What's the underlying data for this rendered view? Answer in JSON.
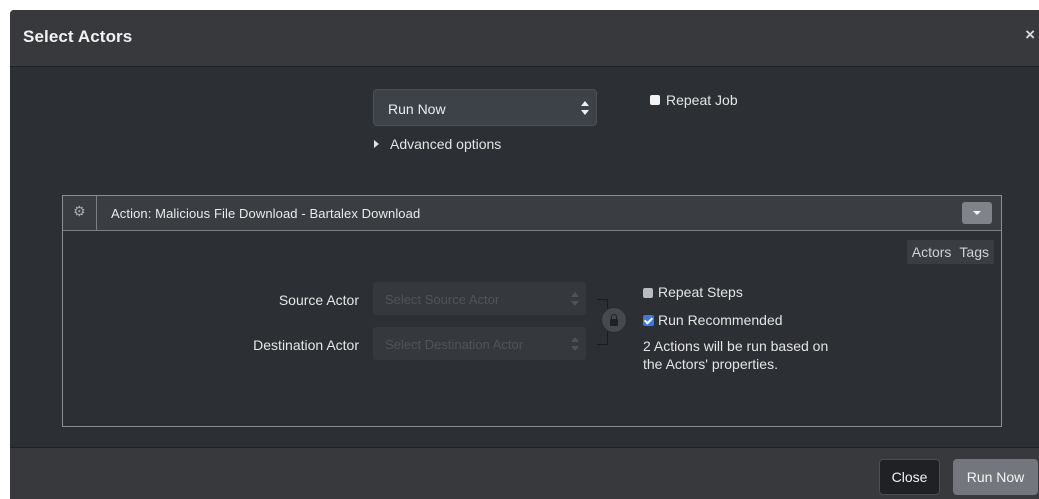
{
  "modal": {
    "title": "Select Actors",
    "close_glyph": "×"
  },
  "schedule": {
    "selected": "Run Now",
    "repeat_job_label": "Repeat Job",
    "repeat_job_checked": false,
    "advanced_label": "Advanced options"
  },
  "action": {
    "title": "Action: Malicious File Download - Bartalex Download",
    "tabs": [
      "Actors",
      "Tags"
    ],
    "source_label": "Source Actor",
    "source_placeholder": "Select Source Actor",
    "destination_label": "Destination Actor",
    "destination_placeholder": "Select Destination Actor",
    "repeat_steps_label": "Repeat Steps",
    "repeat_steps_checked": false,
    "run_recommended_label": "Run Recommended",
    "run_recommended_checked": true,
    "info_line1": "2 Actions will be run based on",
    "info_line2": "the Actors' properties."
  },
  "footer": {
    "close_label": "Close",
    "run_label": "Run Now"
  },
  "colors": {
    "modal_bg": "#2c2f33",
    "header_bg": "#37393d",
    "checkbox_blue": "#3b78e0",
    "primary_btn": "#73777d"
  }
}
